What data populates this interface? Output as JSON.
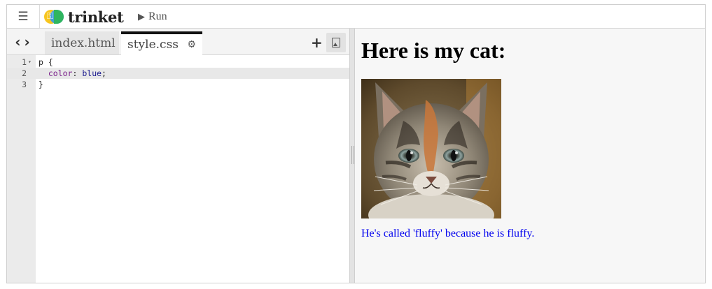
{
  "topbar": {
    "menu_icon": "hamburger-icon",
    "logo_text": "trinket",
    "run_label": "Run"
  },
  "editor": {
    "tabs": [
      {
        "label": "index.html",
        "active": false
      },
      {
        "label": "style.css",
        "active": true,
        "icon": "gear-icon"
      }
    ],
    "nav_icons": [
      "chevron-left-icon",
      "chevron-right-icon"
    ],
    "add_icon": "plus-icon",
    "image_icon": "image-icon",
    "code": {
      "lines": [
        {
          "num": "1",
          "selector": "p {",
          "fold": "▾"
        },
        {
          "num": "2",
          "indent": "  ",
          "prop": "color",
          "sep": ": ",
          "value": "blue",
          "end": ";"
        },
        {
          "num": "3",
          "text": "}"
        }
      ],
      "active_line": 2
    }
  },
  "preview": {
    "heading": "Here is my cat:",
    "image": "kitten-photo",
    "caption": "He's called 'fluffy' because he is fluffy.",
    "caption_color": "#0000ee"
  },
  "colors": {
    "logo_yellow": "#f7c51e",
    "logo_blue": "#3a9ee0",
    "logo_green": "#2fb55f",
    "active_tab_border": "#111111"
  }
}
